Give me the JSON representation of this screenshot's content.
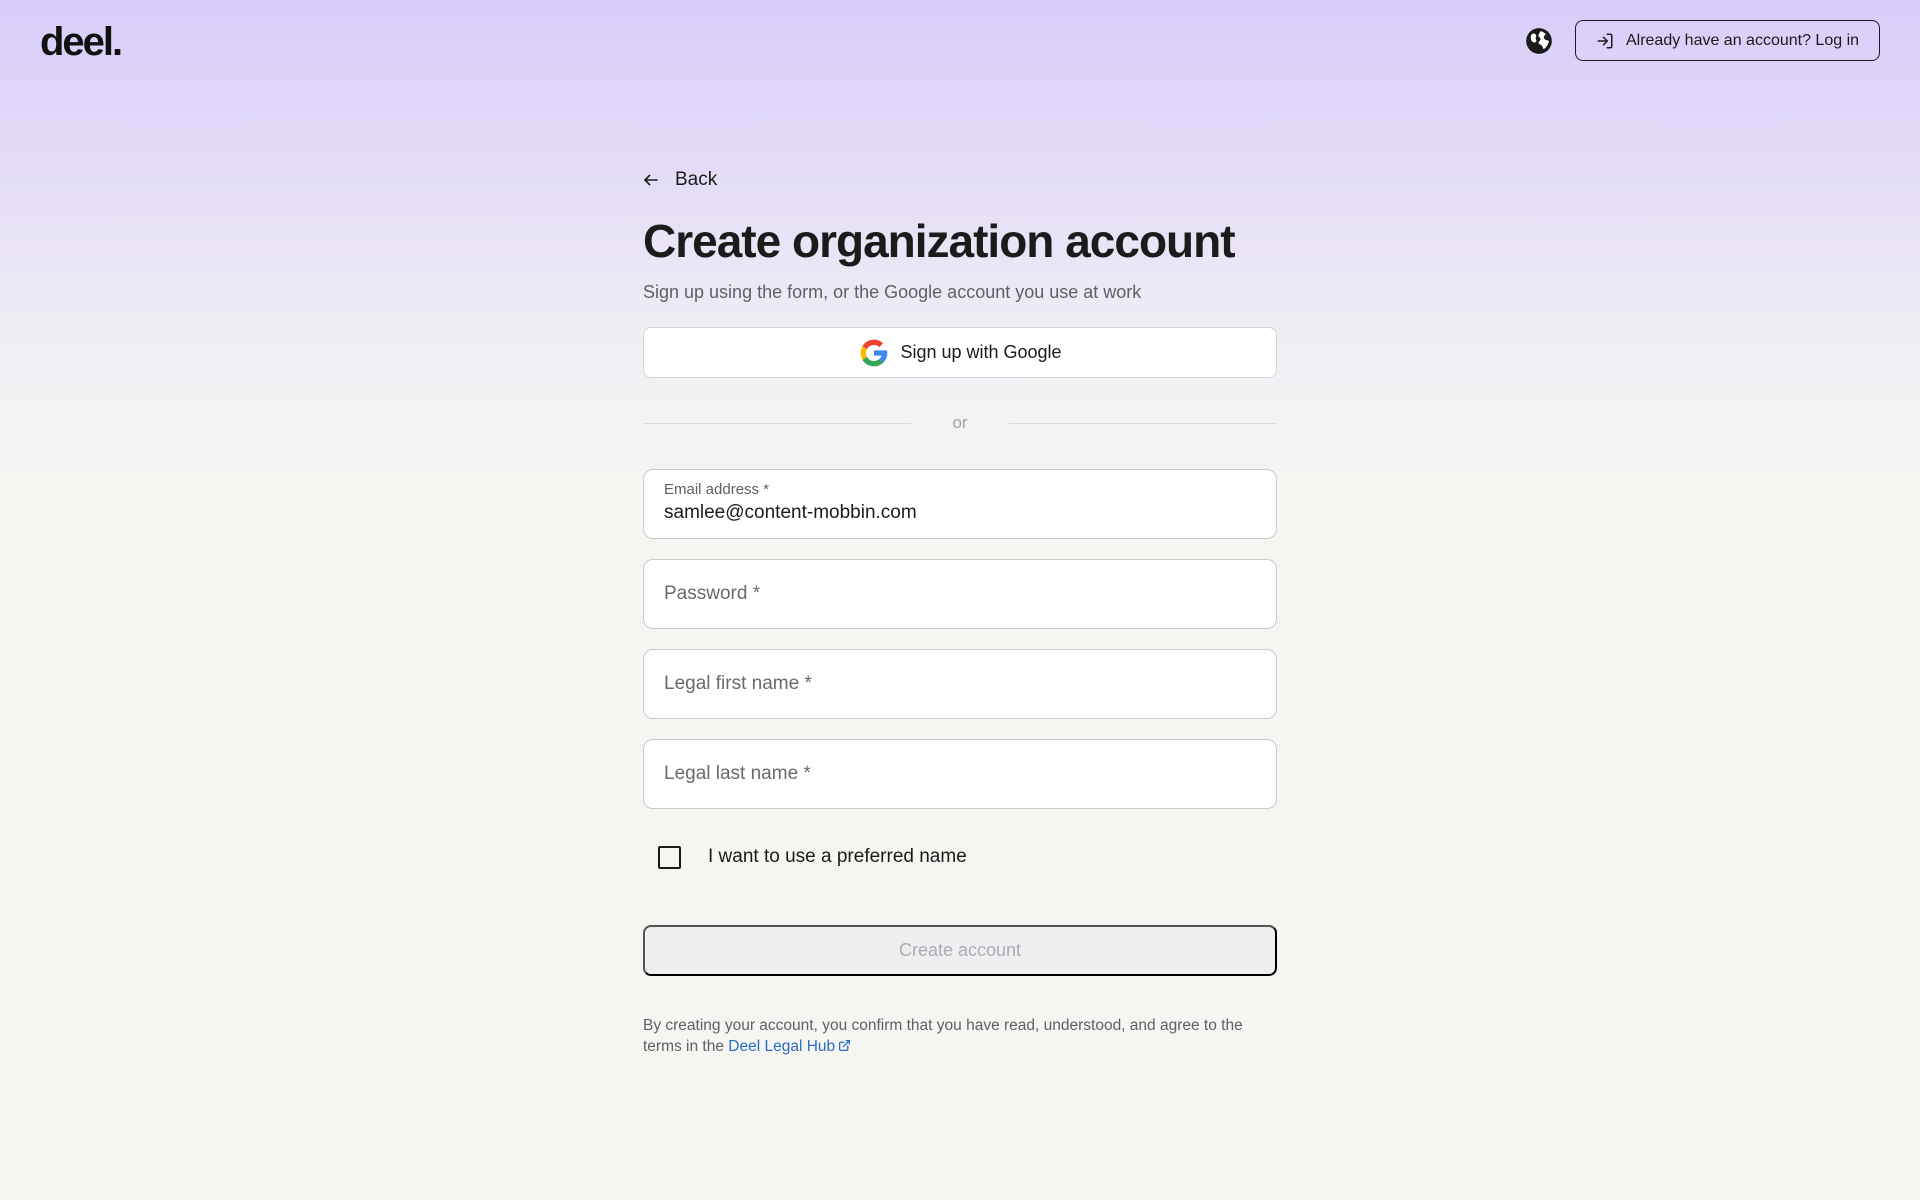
{
  "header": {
    "logo": "deel.",
    "login_button": "Already have an account? Log in"
  },
  "form": {
    "back_label": "Back",
    "title": "Create organization account",
    "subtitle": "Sign up using the form, or the Google account you use at work",
    "google_button": "Sign up with Google",
    "divider_text": "or",
    "email": {
      "label": "Email address *",
      "value": "samlee@content-mobbin.com"
    },
    "password": {
      "label": "Password *",
      "value": ""
    },
    "first_name": {
      "label": "Legal first name *",
      "value": ""
    },
    "last_name": {
      "label": "Legal last name *",
      "value": ""
    },
    "preferred_name_checkbox": {
      "label": "I want to use a preferred name",
      "checked": false
    },
    "create_button": "Create account",
    "legal_text": "By creating your account, you confirm that you have read, understood, and agree to the terms in the",
    "legal_link": "Deel Legal Hub"
  },
  "icons": {
    "globe": "globe-icon",
    "login": "login-icon",
    "back": "arrow-left-icon",
    "google": "google-icon",
    "external": "external-link-icon"
  },
  "colors": {
    "link": "#2c6cc6",
    "gradient_top": "#d8cdfa",
    "background": "#f6f5f2"
  }
}
